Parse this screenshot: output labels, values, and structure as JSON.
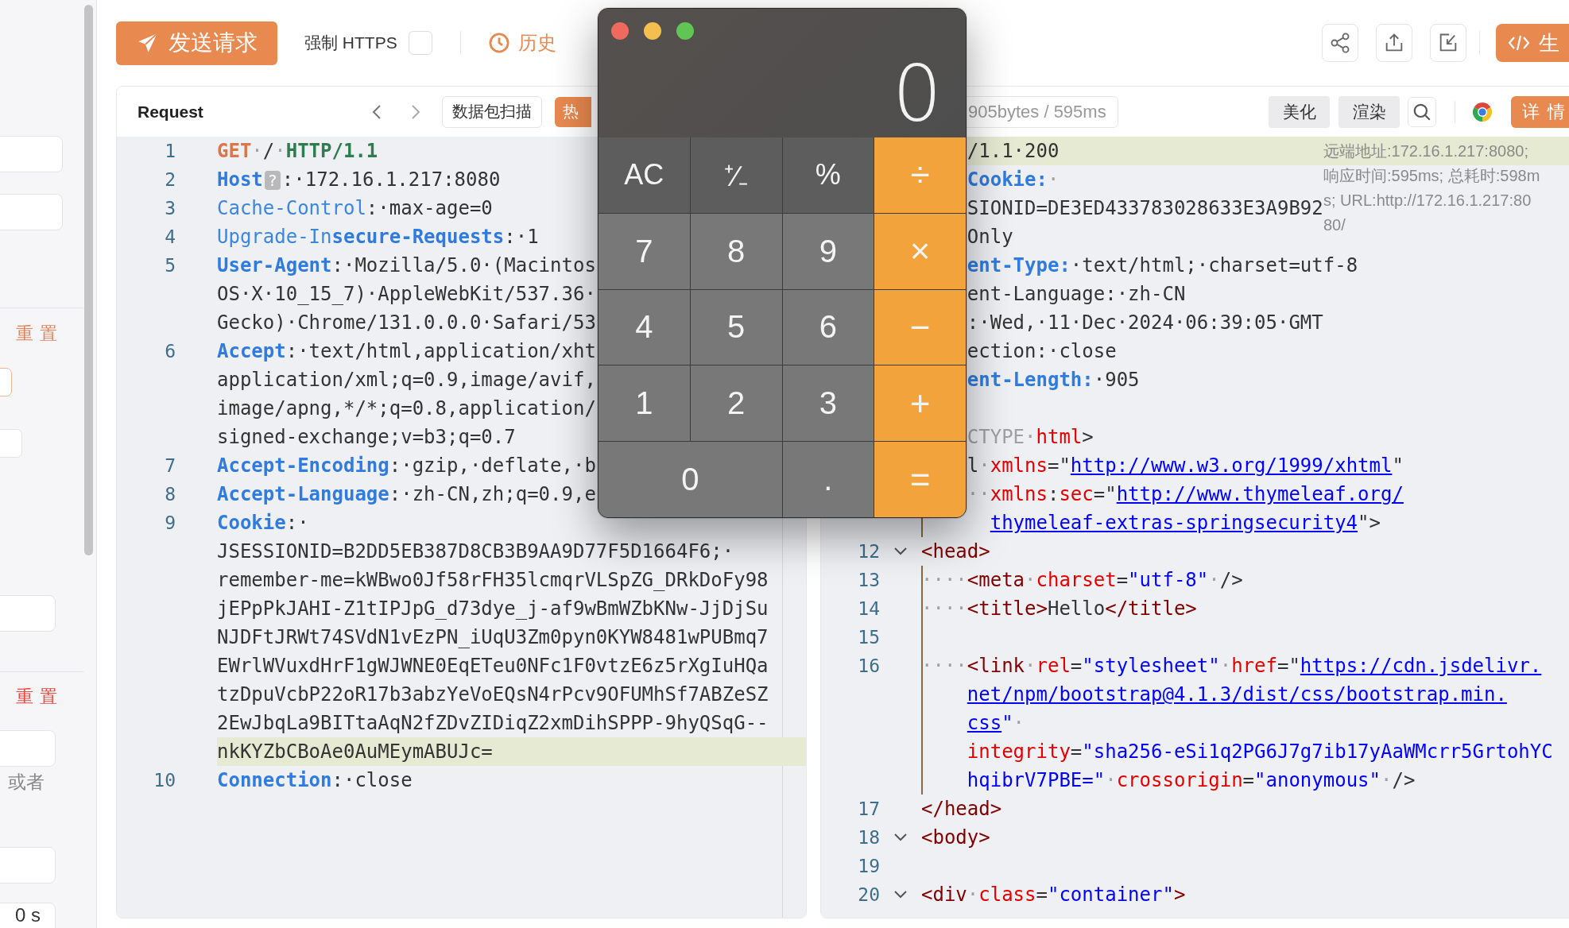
{
  "sidebar": {
    "items": [
      {
        "kind": "field"
      },
      {
        "kind": "field"
      },
      {
        "kind": "divider"
      },
      {
        "kind": "reset",
        "label": "重 置",
        "color": "#e0835a"
      },
      {
        "kind": "outline-button"
      },
      {
        "kind": "button"
      },
      {
        "kind": "field"
      },
      {
        "kind": "divider"
      },
      {
        "kind": "reset",
        "label": "重 置",
        "color": "#e5483d"
      },
      {
        "kind": "field"
      },
      {
        "kind": "hint",
        "label": "或者"
      },
      {
        "kind": "field"
      },
      {
        "kind": "field",
        "value": "0 s"
      }
    ]
  },
  "toolbar": {
    "send_button": "发送请求",
    "force_https": {
      "label": "强制 HTTPS",
      "checked": false
    },
    "history": "历史",
    "generate_button": "生"
  },
  "request": {
    "title": "Request",
    "scan_button": "数据包扫描",
    "hot_button": "热",
    "rows": [
      {
        "num": "1",
        "segs": [
          {
            "kind": "method",
            "text": "GET"
          },
          {
            "kind": "gray",
            "text": "·"
          },
          {
            "kind": "p",
            "text": "/"
          },
          {
            "kind": "gray",
            "text": "·"
          },
          {
            "kind": "ver",
            "text": "HTTP/1.1"
          }
        ]
      },
      {
        "num": "2",
        "segs": [
          {
            "kind": "keyb",
            "text": "Host"
          },
          {
            "kind": "badge",
            "text": "?"
          },
          {
            "kind": "p",
            "text": ":·172.16.1.217:8080"
          }
        ]
      },
      {
        "num": "3",
        "segs": [
          {
            "kind": "key",
            "text": "Cache-Control"
          },
          {
            "kind": "p",
            "text": ":·max-age=0"
          }
        ]
      },
      {
        "num": "4",
        "segs": [
          {
            "kind": "key",
            "text": "Upgrade-In"
          },
          {
            "kind": "keyb",
            "text": "secure-Requests"
          },
          {
            "kind": "p",
            "text": ":·1"
          }
        ]
      },
      {
        "num": "5",
        "segs": [
          {
            "kind": "keyb",
            "text": "User-Agent"
          },
          {
            "kind": "p",
            "text": ":·Mozilla/5.0·(Macintos"
          }
        ]
      },
      {
        "segs": [
          {
            "kind": "p",
            "text": "OS·X·10_15_7)·AppleWebKit/537.36·"
          }
        ]
      },
      {
        "segs": [
          {
            "kind": "p",
            "text": "Gecko)·Chrome/131.0.0.0·Safari/53"
          }
        ]
      },
      {
        "num": "6",
        "segs": [
          {
            "kind": "keyb",
            "text": "Accept"
          },
          {
            "kind": "p",
            "text": ":·text/html,application/xht"
          }
        ]
      },
      {
        "segs": [
          {
            "kind": "p",
            "text": "application/xml;q=0.9,image/avif,"
          }
        ]
      },
      {
        "segs": [
          {
            "kind": "p",
            "text": "image/apng,*/*;q=0.8,application/"
          }
        ]
      },
      {
        "segs": [
          {
            "kind": "p",
            "text": "signed-exchange;v=b3;q=0.7"
          }
        ]
      },
      {
        "num": "7",
        "segs": [
          {
            "kind": "keyb",
            "text": "Accept-Encoding"
          },
          {
            "kind": "p",
            "text": ":·gzip,·deflate,·b"
          }
        ]
      },
      {
        "num": "8",
        "segs": [
          {
            "kind": "keyb",
            "text": "Accept-Language"
          },
          {
            "kind": "p",
            "text": ":·zh-CN,zh;q=0.9,e"
          }
        ]
      },
      {
        "num": "9",
        "segs": [
          {
            "kind": "keyb",
            "text": "Cookie"
          },
          {
            "kind": "p",
            "text": ":·"
          }
        ]
      },
      {
        "segs": [
          {
            "kind": "p",
            "text": "JSESSIONID=B2DD5EB387D8CB3B9AA9D77F5D1664F6;·"
          }
        ]
      },
      {
        "segs": [
          {
            "kind": "p",
            "text": "remember-me=kWBwo0Jf58rFH35lcmqrVLSpZG_DRkDoFy98"
          }
        ]
      },
      {
        "segs": [
          {
            "kind": "p",
            "text": "jEPpPkJAHI-Z1tIPJpG_d73dye_j-af9wBmWZbKNw-JjDjSu"
          }
        ]
      },
      {
        "segs": [
          {
            "kind": "p",
            "text": "NJDFtJRWt74SVdN1vEzPN_iUqU3Zm0pyn0KYW8481wPUBmq7"
          }
        ]
      },
      {
        "segs": [
          {
            "kind": "p",
            "text": "EWrlWVuxdHrF1gWJWNE0EqETeu0NFc1F0vtzE6z5rXgIuHQa"
          }
        ]
      },
      {
        "segs": [
          {
            "kind": "p",
            "text": "tzDpuVcbP22oR17b3abzYeVoEQsN4rPcv9OFUMhSf7ABZeSZ"
          }
        ]
      },
      {
        "segs": [
          {
            "kind": "p",
            "text": "2EwJbqLa9BITtaAqN2fZDvZIDiqZ2xmDihSPPP-9hyQSqG--"
          }
        ]
      },
      {
        "segs": [
          {
            "kind": "p",
            "text": "nkKYZbCBoAe0AuMEymABUJc="
          }
        ],
        "highlighted": true
      },
      {
        "num": "10",
        "segs": [
          {
            "kind": "keyb",
            "text": "Connection"
          },
          {
            "kind": "p",
            "text": ":·close"
          }
        ]
      }
    ]
  },
  "response": {
    "stats": "905bytes / 595ms",
    "buttons": [
      "美化",
      "渲染"
    ],
    "details_button": "详 情",
    "info": [
      "远端地址:172.16.1.217:8080;",
      "响应时间:595ms; 总耗时:598m",
      "s; URL:http://172.16.1.217:80",
      "80/"
    ],
    "rows": [
      {
        "kind": "cont",
        "segs": [
          {
            "kind": "p",
            "text": "/1.1·200"
          }
        ],
        "highlighted": true
      },
      {
        "kind": "cont",
        "segs": [
          {
            "kind": "keyb",
            "text": "Cookie:"
          },
          {
            "kind": "gray",
            "text": "·"
          }
        ]
      },
      {
        "kind": "cont",
        "segs": [
          {
            "kind": "p",
            "text": "SIONID=DE3ED433783028633E3A9B92"
          }
        ]
      },
      {
        "kind": "cont",
        "segs": [
          {
            "kind": "p",
            "text": "Only"
          }
        ]
      },
      {
        "kind": "cont",
        "segs": [
          {
            "kind": "keyb",
            "text": "ent-Type:"
          },
          {
            "kind": "p",
            "text": "·text/html;·charset=utf-8"
          }
        ]
      },
      {
        "kind": "cont",
        "segs": [
          {
            "kind": "p",
            "text": "ent-Language:·zh-CN"
          }
        ]
      },
      {
        "kind": "cont",
        "segs": [
          {
            "kind": "p",
            "text": ":·Wed,·11·Dec·2024·06:39:05·GMT"
          }
        ]
      },
      {
        "kind": "cont",
        "segs": [
          {
            "kind": "p",
            "text": "ection:·close"
          }
        ]
      },
      {
        "kind": "cont",
        "segs": [
          {
            "kind": "keyb",
            "text": "ent-Length:"
          },
          {
            "kind": "p",
            "text": "·905"
          }
        ]
      },
      {
        "kind": "cont"
      },
      {
        "kind": "cont",
        "segs": [
          {
            "kind": "gray",
            "text": "CTYPE·"
          },
          {
            "kind": "attr",
            "text": "html"
          },
          {
            "kind": "p",
            "text": ">"
          }
        ]
      },
      {
        "kind": "cont",
        "segs": [
          {
            "kind": "p",
            "text": "l"
          },
          {
            "kind": "gray",
            "text": "·"
          },
          {
            "kind": "attr",
            "text": "xmlns"
          },
          {
            "kind": "p",
            "text": "=\""
          },
          {
            "kind": "link",
            "text": "http://www.w3.org/1999/xhtml"
          },
          {
            "kind": "p",
            "text": "\""
          }
        ]
      },
      {
        "kind": "cont",
        "segs": [
          {
            "kind": "gray",
            "text": "··"
          },
          {
            "kind": "attr",
            "text": "xmlns"
          },
          {
            "kind": "p",
            "text": ":"
          },
          {
            "kind": "attr",
            "text": "sec"
          },
          {
            "kind": "p",
            "text": "=\""
          },
          {
            "kind": "link",
            "text": "http://www.thymeleaf.org/"
          }
        ]
      },
      {
        "kind": "deep",
        "guide": true,
        "segs": [
          {
            "kind": "link",
            "text": "thymeleaf-extras-springsecurity4"
          },
          {
            "kind": "p",
            "text": "\">"
          }
        ]
      },
      {
        "num": "12",
        "expanded": true,
        "segs": [
          {
            "kind": "tag",
            "text": "<head>"
          }
        ]
      },
      {
        "num": "13",
        "guide": true,
        "segs": [
          {
            "kind": "gray",
            "text": "····"
          },
          {
            "kind": "tag",
            "text": "<meta"
          },
          {
            "kind": "gray",
            "text": "·"
          },
          {
            "kind": "attr",
            "text": "charset"
          },
          {
            "kind": "p",
            "text": "="
          },
          {
            "kind": "str",
            "text": "\"utf-8\""
          },
          {
            "kind": "gray",
            "text": "·"
          },
          {
            "kind": "p",
            "text": "/>"
          }
        ]
      },
      {
        "num": "14",
        "guide": true,
        "segs": [
          {
            "kind": "gray",
            "text": "····"
          },
          {
            "kind": "tag",
            "text": "<title>"
          },
          {
            "kind": "p",
            "text": "Hello"
          },
          {
            "kind": "tag",
            "text": "</title>"
          }
        ]
      },
      {
        "num": "15",
        "guide": true
      },
      {
        "num": "16",
        "guide": true,
        "segs": [
          {
            "kind": "gray",
            "text": "····"
          },
          {
            "kind": "tag",
            "text": "<link"
          },
          {
            "kind": "gray",
            "text": "·"
          },
          {
            "kind": "attr",
            "text": "rel"
          },
          {
            "kind": "p",
            "text": "="
          },
          {
            "kind": "str",
            "text": "\"stylesheet\""
          },
          {
            "kind": "gray",
            "text": "·"
          },
          {
            "kind": "attr",
            "text": "href"
          },
          {
            "kind": "p",
            "text": "=\""
          },
          {
            "kind": "link",
            "text": "https://cdn.jsdelivr."
          }
        ]
      },
      {
        "kind": "cont",
        "guide": true,
        "segs": [
          {
            "kind": "link",
            "text": "net/npm/bootstrap@4.1.3/dist/css/bootstrap.min."
          }
        ]
      },
      {
        "kind": "cont",
        "guide": true,
        "segs": [
          {
            "kind": "link",
            "text": "css"
          },
          {
            "kind": "str",
            "text": "\""
          },
          {
            "kind": "gray",
            "text": "·"
          }
        ]
      },
      {
        "kind": "cont",
        "guide": true,
        "segs": [
          {
            "kind": "attr",
            "text": "integrity"
          },
          {
            "kind": "p",
            "text": "="
          },
          {
            "kind": "str",
            "text": "\"sha256-eSi1q2PG6J7g7ib17yAaWMcrr5GrtohYC"
          }
        ]
      },
      {
        "kind": "cont",
        "guide": true,
        "segs": [
          {
            "kind": "str",
            "text": "hqibrV7PBE=\""
          },
          {
            "kind": "gray",
            "text": "·"
          },
          {
            "kind": "attr",
            "text": "crossorigin"
          },
          {
            "kind": "p",
            "text": "="
          },
          {
            "kind": "str",
            "text": "\"anonymous\""
          },
          {
            "kind": "gray",
            "text": "·"
          },
          {
            "kind": "p",
            "text": "/>"
          }
        ]
      },
      {
        "num": "17",
        "segs": [
          {
            "kind": "tag",
            "text": "</head>"
          }
        ]
      },
      {
        "num": "18",
        "expanded": true,
        "segs": [
          {
            "kind": "tag",
            "text": "<body>"
          }
        ]
      },
      {
        "num": "19"
      },
      {
        "num": "20",
        "expanded": true,
        "segs": [
          {
            "kind": "tag",
            "text": "<div"
          },
          {
            "kind": "gray",
            "text": "·"
          },
          {
            "kind": "attr",
            "text": "class"
          },
          {
            "kind": "p",
            "text": "="
          },
          {
            "kind": "str",
            "text": "\"container\""
          },
          {
            "kind": "tag",
            "text": ">"
          }
        ]
      }
    ]
  },
  "calculator": {
    "display": "0",
    "keys": [
      {
        "label": "AC",
        "kind": "function"
      },
      {
        "label": "⁺∕₋",
        "kind": "function"
      },
      {
        "label": "%",
        "kind": "function"
      },
      {
        "label": "÷",
        "kind": "operator"
      },
      {
        "label": "7",
        "kind": "digit"
      },
      {
        "label": "8",
        "kind": "digit"
      },
      {
        "label": "9",
        "kind": "digit"
      },
      {
        "label": "×",
        "kind": "operator"
      },
      {
        "label": "4",
        "kind": "digit"
      },
      {
        "label": "5",
        "kind": "digit"
      },
      {
        "label": "6",
        "kind": "digit"
      },
      {
        "label": "−",
        "kind": "operator"
      },
      {
        "label": "1",
        "kind": "digit"
      },
      {
        "label": "2",
        "kind": "digit"
      },
      {
        "label": "3",
        "kind": "digit"
      },
      {
        "label": "+",
        "kind": "operator"
      },
      {
        "label": "0",
        "kind": "digit",
        "wide": true
      },
      {
        "label": ".",
        "kind": "digit"
      },
      {
        "label": "=",
        "kind": "operator"
      }
    ]
  }
}
